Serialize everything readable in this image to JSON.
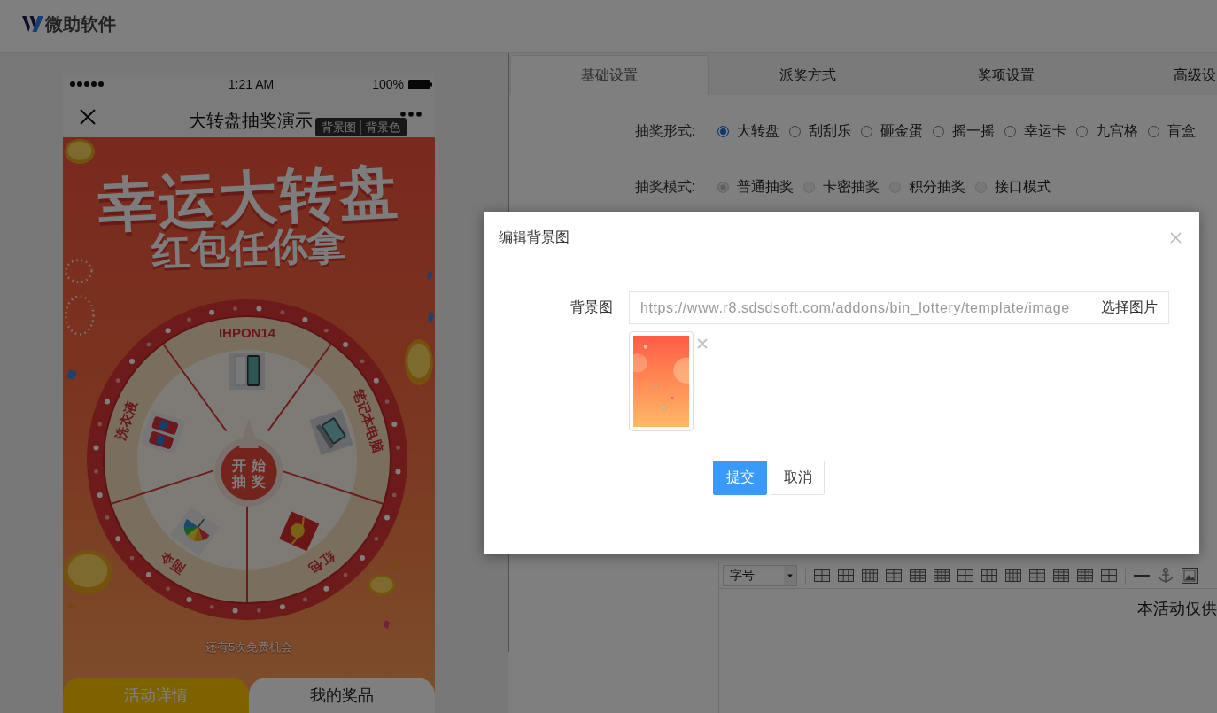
{
  "header": {
    "brand": "微助软件"
  },
  "preview": {
    "status_bar": {
      "time": "1:21 AM",
      "battery": "100%"
    },
    "nav": {
      "title": "大转盘抽奖演示"
    },
    "edit_tags": [
      {
        "label": "背景图"
      },
      {
        "label": "背景色"
      }
    ],
    "banner": {
      "title": "幸运大转盘",
      "subtitle": "红包任你拿"
    },
    "wheel": {
      "prizes": [
        {
          "label": "IHPON14",
          "kind": "phone"
        },
        {
          "label": "笔记本电脑",
          "kind": "laptop"
        },
        {
          "label": "红包",
          "kind": "envelope"
        },
        {
          "label": "雨伞",
          "kind": "umbrella"
        },
        {
          "label": "洗衣液",
          "kind": "detergent"
        }
      ],
      "start_button": "开始抽奖"
    },
    "chances": "还有5次免费机会",
    "tabs": [
      {
        "label": "活动详情",
        "selected": true
      },
      {
        "label": "我的奖品",
        "selected": false
      }
    ]
  },
  "settings": {
    "tabs": [
      {
        "label": "基础设置",
        "selected": true
      },
      {
        "label": "派奖方式",
        "selected": false
      },
      {
        "label": "奖项设置",
        "selected": false
      },
      {
        "label": "高级设",
        "selected": false
      }
    ],
    "fields": [
      {
        "label": "抽奖形式:",
        "options": [
          {
            "label": "大转盘",
            "selected": true,
            "disabled": false
          },
          {
            "label": "刮刮乐",
            "selected": false,
            "disabled": false
          },
          {
            "label": "砸金蛋",
            "selected": false,
            "disabled": false
          },
          {
            "label": "摇一摇",
            "selected": false,
            "disabled": false
          },
          {
            "label": "幸运卡",
            "selected": false,
            "disabled": false
          },
          {
            "label": "九宫格",
            "selected": false,
            "disabled": false
          },
          {
            "label": "盲盒",
            "selected": false,
            "disabled": false
          }
        ]
      },
      {
        "label": "抽奖模式:",
        "options": [
          {
            "label": "普通抽奖",
            "selected": true,
            "disabled": true
          },
          {
            "label": "卡密抽奖",
            "selected": false,
            "disabled": true
          },
          {
            "label": "积分抽奖",
            "selected": false,
            "disabled": true
          },
          {
            "label": "接口模式",
            "selected": false,
            "disabled": true
          }
        ]
      }
    ],
    "editor": {
      "font_size": "字号",
      "content": "本活动仅供"
    }
  },
  "dialog": {
    "title": "编辑背景图",
    "field": {
      "label": "背景图",
      "value": "https://www.r8.sdsdsoft.com/addons/bin_lottery/template/image",
      "button": "选择图片"
    },
    "buttons": [
      {
        "label": "提交",
        "kind": "primary"
      },
      {
        "label": "取消",
        "kind": "default"
      }
    ]
  }
}
